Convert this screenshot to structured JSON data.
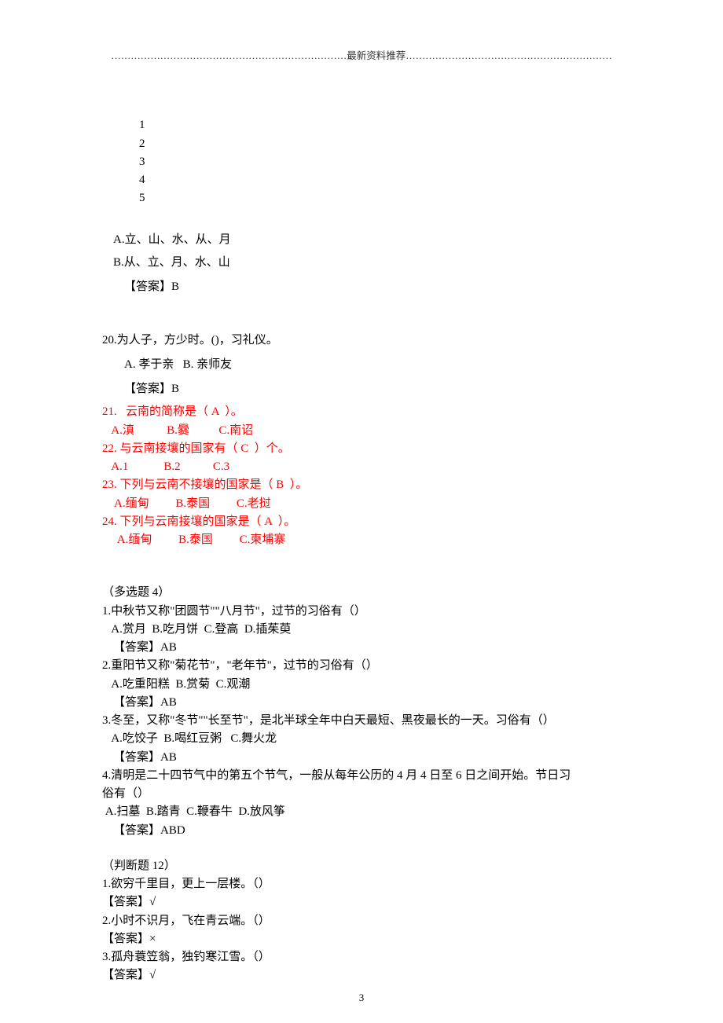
{
  "header": "………………………………………………………………最新资料推荐………………………………………………………",
  "q_nums": {
    "n1": "1",
    "n2": "2",
    "n3": "3",
    "n4": "4",
    "n5": "5"
  },
  "qA": "A.立、山、水、从、月",
  "qB": "B.从、立、月、水、山",
  "ansB": "【答案】B",
  "q20": {
    "stem": "20.为人子，方少时。()，习礼仪。",
    "options": "A. 孝于亲   B. 亲师友",
    "answer": "【答案】B"
  },
  "red": {
    "q21_stem": "21.   云南的简称是（ A  ）。",
    "q21_opt": "   A.滇           B.爨          C.南诏",
    "q22_stem": "22. 与云南接壤的国家有（ C  ）个。",
    "q22_opt": "   A.1            B.2           C.3",
    "q23_stem": "23. 下列与云南不接壤的国家是（ B  ）。",
    "q23_opt": "    A.缅甸         B.泰国         C.老挝",
    "q24_stem": "24. 下列与云南接壤的国家是（ A  ）。",
    "q24_opt": "     A.缅甸         B.泰国         C.柬埔寨"
  },
  "multi": {
    "title": "（多选题 4）",
    "q1_stem": "1.中秋节又称\"团圆节\"\"八月节\"，过节的习俗有（）",
    "q1_opt": "   A.赏月  B.吃月饼  C.登高  D.插茱萸",
    "q1_ans": "【答案】AB",
    "q2_stem": "2.重阳节又称\"菊花节\"，\"老年节\"，过节的习俗有（）",
    "q2_opt": "   A.吃重阳糕  B.赏菊  C.观潮",
    "q2_ans": "【答案】AB",
    "q3_stem": "3.冬至，又称\"冬节\"\"长至节\"，是北半球全年中白天最短、黑夜最长的一天。习俗有（）",
    "q3_opt": "   A.吃饺子  B.喝红豆粥   C.舞火龙",
    "q3_ans": "【答案】AB",
    "q4_stem_a": "4.清明是二十四节气中的第五个节气，一般从每年公历的 4 月 4 日至 6 日之间开始。节日习",
    "q4_stem_b": "俗有（）",
    "q4_opt": " A.扫墓  B.踏青  C.鞭春牛  D.放风筝",
    "q4_ans": "【答案】ABD"
  },
  "tf": {
    "title": "（判断题 12）",
    "q1": "1.欲穷千里目，更上一层楼。（）",
    "a1": "【答案】√",
    "q2": "2.小时不识月，飞在青云端。（）",
    "a2": "【答案】×",
    "q3": "3.孤舟蓑笠翁，独钓寒江雪。（）",
    "a3": "【答案】√"
  },
  "pageNumber": "3"
}
